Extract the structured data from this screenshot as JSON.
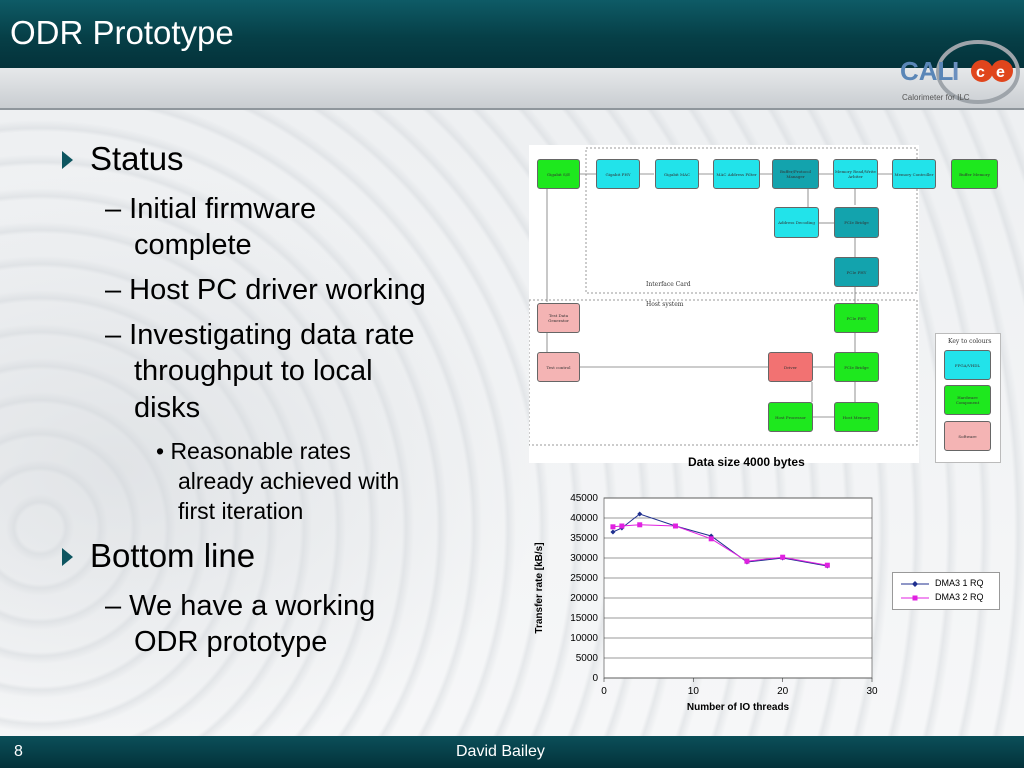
{
  "slide": {
    "title": "ODR Prototype",
    "footer_number": "8",
    "footer_author": "David Bailey"
  },
  "logo": {
    "brand": "CALICE",
    "tagline": "Calorimeter for ILC"
  },
  "bullets": {
    "status": "Status",
    "status_items": [
      "– Initial firmware",
      "complete",
      "– Host PC driver working",
      "– Investigating data rate",
      "throughput to local",
      "disks"
    ],
    "status_sub": [
      "• Reasonable rates",
      "already achieved with",
      "first iteration"
    ],
    "bottom": "Bottom line",
    "bottom_items": [
      "– We have a working",
      "ODR prototype"
    ]
  },
  "diagram": {
    "boxes": [
      "Gigabit S/E",
      "Gigabit PHY",
      "Gigabit MAC",
      "MAC Address Filter",
      "Buffer/Protocol Manager",
      "Memory Read/Write Arbiter",
      "Memory Controller",
      "Buffer Memory",
      "Address Decoding",
      "PCIe Bridge",
      "PCIe PHY",
      "Test Data Generator",
      "PCIe PHY",
      "Test control",
      "Driver",
      "PCIe Bridge",
      "Host Processor",
      "Host Memory"
    ],
    "interface_label": "Interface Card",
    "host_label": "Host system",
    "key_title": "Key to colours",
    "key_items": [
      "FPGA/VHDL",
      "Hardware Component",
      "Software"
    ]
  },
  "chart_caption": "Data size 4000 bytes",
  "colors": {
    "series1": "#1f2f8f",
    "series2": "#e021e0"
  },
  "chart_data": {
    "type": "line",
    "xlabel": "Number of IO threads",
    "ylabel": "Transfer rate [kB/s]",
    "xlim": [
      0,
      30
    ],
    "ylim": [
      0,
      45000
    ],
    "xticks": [
      0,
      10,
      20,
      30
    ],
    "yticks": [
      0,
      5000,
      10000,
      15000,
      20000,
      25000,
      30000,
      35000,
      40000,
      45000
    ],
    "series": [
      {
        "name": "DMA3 1 RQ",
        "x": [
          1,
          2,
          4,
          8,
          12,
          16,
          20,
          25
        ],
        "values": [
          36500,
          37500,
          41000,
          38000,
          35500,
          29000,
          30000,
          28000
        ]
      },
      {
        "name": "DMA3 2 RQ",
        "x": [
          1,
          2,
          4,
          8,
          12,
          16,
          20,
          25
        ],
        "values": [
          37800,
          38000,
          38300,
          38000,
          34800,
          29200,
          30200,
          28200
        ]
      }
    ]
  }
}
